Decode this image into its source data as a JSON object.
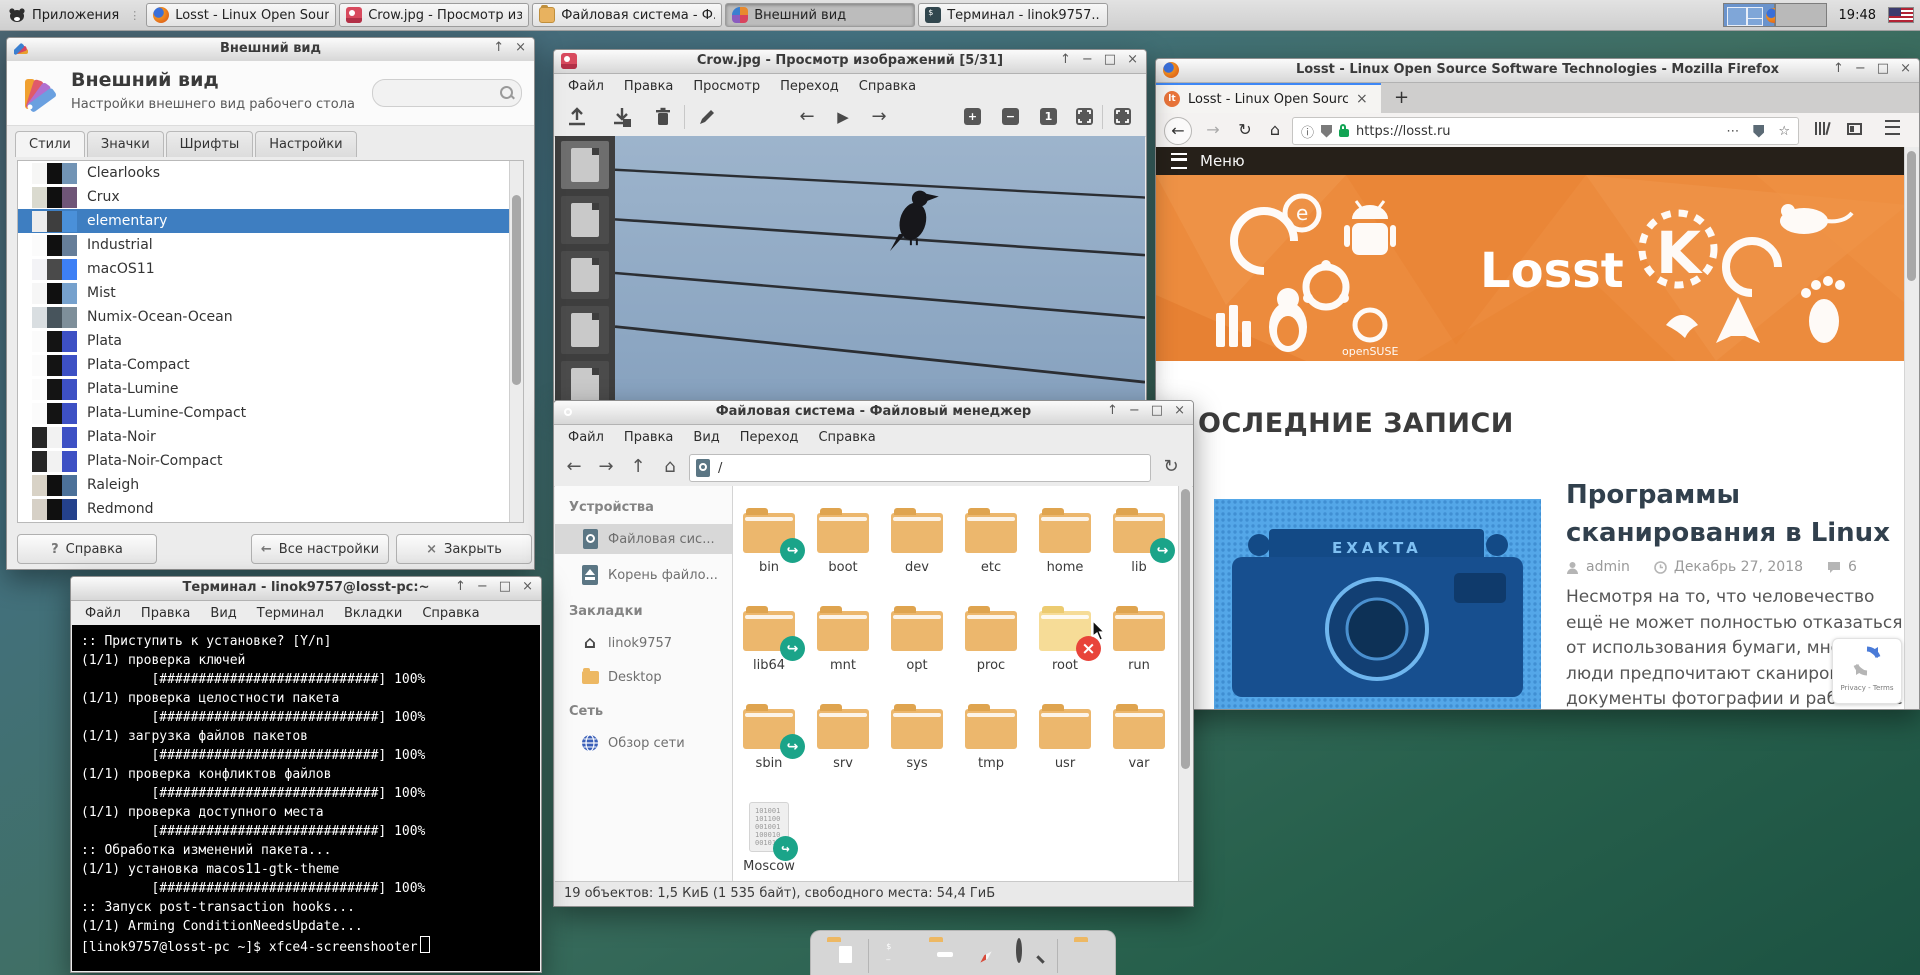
{
  "panel": {
    "app_menu_label": "Приложения",
    "taskbar_buttons": [
      {
        "icon": "firefox",
        "label": "Losst - Linux Open Sour...",
        "active": false
      },
      {
        "icon": "image-viewer",
        "label": "Crow.jpg - Просмотр из...",
        "active": false
      },
      {
        "icon": "file-manager",
        "label": "Файловая система - Ф...",
        "active": false
      },
      {
        "icon": "appearance",
        "label": "Внешний вид",
        "active": true
      },
      {
        "icon": "terminal",
        "label": "Терминал - linok9757...",
        "active": false
      }
    ],
    "clock": "19:48",
    "workspaces": 2
  },
  "appearance": {
    "window_title": "Внешний вид",
    "header_title": "Внешний вид",
    "header_subtitle": "Настройки внешнего вид рабочего стола",
    "tabs": [
      "Стили",
      "Значки",
      "Шрифты",
      "Настройки"
    ],
    "active_tab": "Стили",
    "selection_color": "#3e7ec1",
    "themes": [
      {
        "name": "Clearlooks",
        "colors": [
          "#f6f6f5",
          "#101010",
          "#7294b5"
        ]
      },
      {
        "name": "Crux",
        "colors": [
          "#dadacf",
          "#101010",
          "#6f5577"
        ]
      },
      {
        "name": "elementary",
        "colors": [
          "#ededed",
          "#3e3e3e",
          "#4a90d9"
        ],
        "selected": true
      },
      {
        "name": "Industrial",
        "colors": [
          "#fbfbfb",
          "#101010",
          "#667e99"
        ]
      },
      {
        "name": "macOS11",
        "colors": [
          "#f3f3f6",
          "#4a4a4a",
          "#3d7ff5"
        ]
      },
      {
        "name": "Mist",
        "colors": [
          "#f6f6f6",
          "#101010",
          "#76a1cd"
        ]
      },
      {
        "name": "Numix-Ocean-Ocean",
        "colors": [
          "#d9dee1",
          "#47545c",
          "#7e8f9a"
        ]
      },
      {
        "name": "Plata",
        "colors": [
          "#fbfbfb",
          "#141414",
          "#3d50c4"
        ]
      },
      {
        "name": "Plata-Compact",
        "colors": [
          "#fbfbfb",
          "#141414",
          "#3d50c4"
        ]
      },
      {
        "name": "Plata-Lumine",
        "colors": [
          "#fbfbfb",
          "#141414",
          "#3d50c4"
        ]
      },
      {
        "name": "Plata-Lumine-Compact",
        "colors": [
          "#fbfbfb",
          "#141414",
          "#3d50c4"
        ]
      },
      {
        "name": "Plata-Noir",
        "colors": [
          "#262626",
          "#f2f2f2",
          "#3d50c4"
        ]
      },
      {
        "name": "Plata-Noir-Compact",
        "colors": [
          "#262626",
          "#f2f2f2",
          "#3d50c4"
        ]
      },
      {
        "name": "Raleigh",
        "colors": [
          "#d8d2c6",
          "#101010",
          "#4c7199"
        ]
      },
      {
        "name": "Redmond",
        "colors": [
          "#d6d0c6",
          "#101010",
          "#24418c"
        ]
      }
    ],
    "buttons": {
      "help": "Справка",
      "all_settings": "Все настройки",
      "close": "Закрыть"
    }
  },
  "crow": {
    "window_title": "Crow.jpg - Просмотр изображений [5/31]",
    "menu": [
      "Файл",
      "Правка",
      "Просмотр",
      "Переход",
      "Справка"
    ],
    "thumbnails": 5
  },
  "fm": {
    "window_title": "Файловая система - Файловый менеджер",
    "menu": [
      "Файл",
      "Правка",
      "Вид",
      "Переход",
      "Справка"
    ],
    "path": "/",
    "sidebar": {
      "devices_header": "Устройства",
      "devices": [
        {
          "label": "Файловая сис...",
          "selected": true
        },
        {
          "label": "Корень файло...",
          "selected": false
        }
      ],
      "bookmarks_header": "Закладки",
      "bookmarks": [
        {
          "label": "linok9757"
        },
        {
          "label": "Desktop"
        }
      ],
      "network_header": "Сеть",
      "network": [
        {
          "label": "Обзор сети"
        }
      ]
    },
    "items": [
      {
        "name": "bin",
        "type": "folder",
        "emblem": "symlink"
      },
      {
        "name": "boot",
        "type": "folder"
      },
      {
        "name": "dev",
        "type": "folder"
      },
      {
        "name": "etc",
        "type": "folder"
      },
      {
        "name": "home",
        "type": "folder"
      },
      {
        "name": "lib",
        "type": "folder",
        "emblem": "symlink"
      },
      {
        "name": "lib64",
        "type": "folder",
        "emblem": "symlink"
      },
      {
        "name": "mnt",
        "type": "folder"
      },
      {
        "name": "opt",
        "type": "folder"
      },
      {
        "name": "proc",
        "type": "folder"
      },
      {
        "name": "root",
        "type": "folder-restricted",
        "emblem": "no-access"
      },
      {
        "name": "run",
        "type": "folder"
      },
      {
        "name": "sbin",
        "type": "folder",
        "emblem": "symlink"
      },
      {
        "name": "srv",
        "type": "folder"
      },
      {
        "name": "sys",
        "type": "folder"
      },
      {
        "name": "tmp",
        "type": "folder"
      },
      {
        "name": "usr",
        "type": "folder"
      },
      {
        "name": "var",
        "type": "folder"
      },
      {
        "name": "Moscow",
        "type": "binary-file",
        "emblem": "symlink"
      }
    ],
    "statusbar": "19 объектов: 1,5 КиБ (1 535 байт), свободного места: 54,4 ГиБ",
    "folder_color": "#ecb76d",
    "symlink_color": "#1ba489",
    "error_color": "#e8443a"
  },
  "firefox": {
    "window_title": "Losst - Linux Open Source Software Technologies - Mozilla Firefox",
    "tab_title": "Losst - Linux Open Sourc",
    "url": "https://losst.ru",
    "menu_label": "Меню",
    "banner_brand": "Losst",
    "section_heading": "ОСЛЕДНИЕ ЗАПИСИ",
    "article": {
      "title": "Программы сканирования в Linux",
      "author": "admin",
      "date": "Декабрь 27, 2018",
      "comments": "6",
      "body": "Несмотря на то, что человечество ещё не может полностью отказаться от использования бумаги, многие люди предпочитают сканировать документы фотографии и работать с ними в"
    },
    "camera_image_label": "EXAKTA",
    "recaptcha_terms": "Privacy - Terms",
    "accent_orange": "#ec8b3d",
    "menu_bar_color": "#262019",
    "tab_accent": "#3d87f5"
  },
  "terminal": {
    "window_title": "Терминал - linok9757@losst-pc:~",
    "menu": [
      "Файл",
      "Правка",
      "Вид",
      "Терминал",
      "Вкладки",
      "Справка"
    ],
    "lines": [
      ":: Приступить к установке? [Y/n]",
      "(1/1) проверка ключей",
      "         [############################] 100%",
      "(1/1) проверка целостности пакета",
      "         [############################] 100%",
      "(1/1) загрузка файлов пакетов",
      "         [############################] 100%",
      "(1/1) проверка конфликтов файлов",
      "         [############################] 100%",
      "(1/1) проверка доступного места",
      "         [############################] 100%",
      ":: Обработка изменений пакета...",
      "(1/1) установка macos11-gtk-theme",
      "         [############################] 100%",
      ":: Запуск post-transaction hooks...",
      "(1/1) Arming ConditionNeedsUpdate...",
      "[linok9757@losst-pc ~]$ xfce4-screenshooter"
    ]
  },
  "icons": {
    "back": "←",
    "forward": "→",
    "up": "↑",
    "home": "⌂",
    "reload": "↻",
    "play": "▶",
    "prev": "←",
    "next": "→",
    "window_shade": "↑",
    "window_minimize": "−",
    "window_maximize": "□",
    "window_close": "×",
    "tab_close": "×",
    "new_tab": "+",
    "ellipsis": "⋯",
    "star": "☆",
    "info": "ⓘ",
    "symlink_arrow": "↪",
    "no_access": "×",
    "help": "?",
    "menu_dots": "⋮",
    "zoom_in": "+",
    "zoom_out": "−",
    "zoom_one": "1"
  }
}
